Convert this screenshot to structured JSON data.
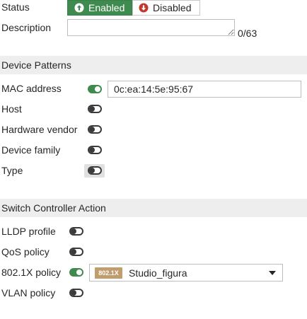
{
  "status": {
    "label": "Status",
    "enabled_label": "Enabled",
    "disabled_label": "Disabled",
    "selected": "Enabled"
  },
  "description": {
    "label": "Description",
    "value": "",
    "counter": "0/63"
  },
  "device_patterns": {
    "title": "Device Patterns",
    "mac_address": {
      "label": "MAC address",
      "enabled": true,
      "value": "0c:ea:14:5e:95:67"
    },
    "host": {
      "label": "Host",
      "enabled": false
    },
    "hardware_vendor": {
      "label": "Hardware vendor",
      "enabled": false
    },
    "device_family": {
      "label": "Device family",
      "enabled": false
    },
    "type": {
      "label": "Type",
      "enabled": false
    }
  },
  "switch_controller_action": {
    "title": "Switch Controller Action",
    "lldp_profile": {
      "label": "LLDP profile",
      "enabled": false
    },
    "qos_policy": {
      "label": "QoS policy",
      "enabled": false
    },
    "dot1x_policy": {
      "label": "802.1X policy",
      "enabled": true,
      "badge": "802.1X",
      "selected": "Studio_figura"
    },
    "vlan_policy": {
      "label": "VLAN policy",
      "enabled": false
    }
  },
  "colors": {
    "accent_green": "#3f8a4f",
    "disabled_red": "#c0392b",
    "badge_tan": "#bf9d6c",
    "section_bg": "#eeeeee"
  }
}
